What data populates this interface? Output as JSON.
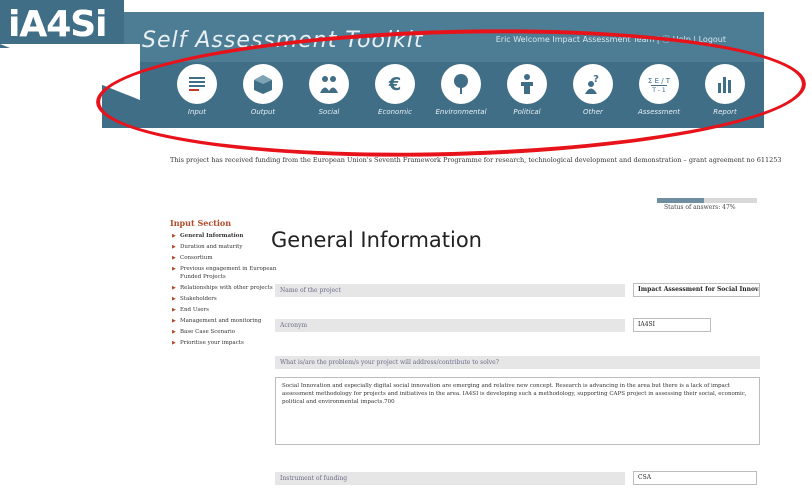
{
  "header": {
    "logo": "iA4Si",
    "title": "Self Assessment Toolkit",
    "user_bar": "Eric Welcome Impact Assessment Team | ⓘ Help | Logout",
    "nav": [
      {
        "label": "Input",
        "icon": "list-icon"
      },
      {
        "label": "Output",
        "icon": "cube-icon"
      },
      {
        "label": "Social",
        "icon": "people-icon"
      },
      {
        "label": "Economic",
        "icon": "euro-icon"
      },
      {
        "label": "Environmental",
        "icon": "tree-icon"
      },
      {
        "label": "Political",
        "icon": "podium-icon"
      },
      {
        "label": "Other",
        "icon": "question-icon"
      },
      {
        "label": "Assessment",
        "icon": "formula-icon"
      },
      {
        "label": "Report",
        "icon": "bar-chart-icon"
      }
    ]
  },
  "funding_text": "This project has received funding from the European Union's Seventh Framework Programme for research, technological development and demonstration – grant agreement no 611253",
  "status": {
    "label": "Status of answers: 47%",
    "percent": 47
  },
  "sidebar": {
    "title": "Input Section",
    "items": [
      "General Information",
      "Duration and maturity",
      "Consortium",
      "Previous engagement in European Funded Projects",
      "Relationships with other projects",
      "Stakeholders",
      "End Users",
      "Management and monitoring",
      "Base Case Scenario",
      "Prioritise your impacts"
    ]
  },
  "main": {
    "title": "General Information",
    "name_label": "Name of the project",
    "name_value": "Impact Assessment for Social Innovation",
    "acronym_label": "Acronym",
    "acronym_value": "IA4SI",
    "problem_label": "What is/are the problem/s your project will address/contribute to solve?",
    "problem_value": "Social Innovation and especially digital social innovation are emerging and relative new concept. Research is advancing in the area but there is a lack of impact assessment methodology for projects and initiatives in the area. IA4SI is developing such a methodology, supporting CAPS project in assessing their social, economic, political and environmental impacts.700",
    "instrument_label": "Instrument of funding",
    "instrument_value": "CSA"
  }
}
